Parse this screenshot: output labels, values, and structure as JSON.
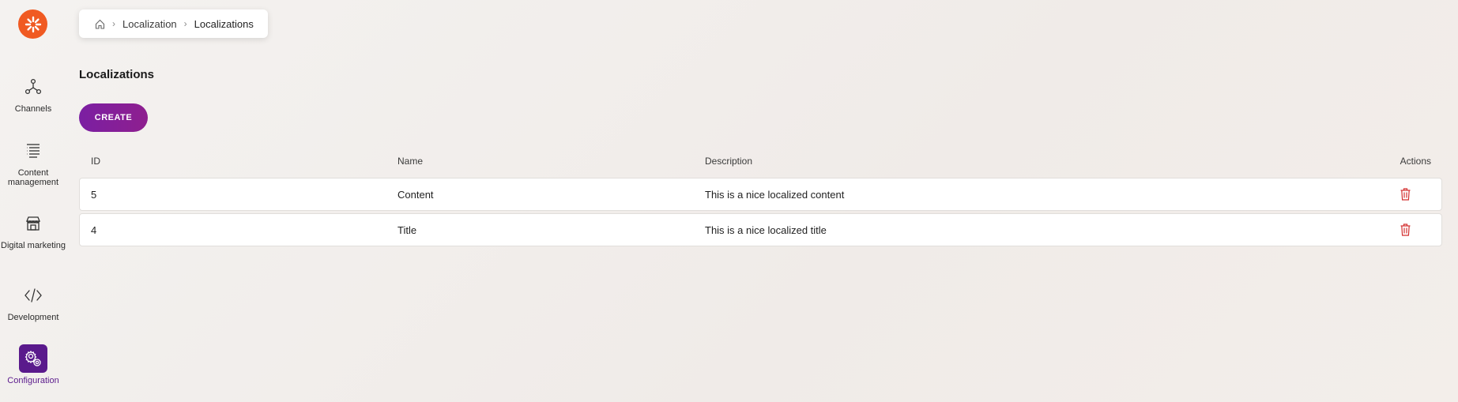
{
  "sidebar": {
    "items": [
      {
        "label": "Channels",
        "icon": "channels-icon"
      },
      {
        "label": "Content management",
        "icon": "content-management-icon"
      },
      {
        "label": "Digital marketing",
        "icon": "digital-marketing-icon"
      },
      {
        "label": "Development",
        "icon": "code-icon"
      },
      {
        "label": "Configuration",
        "icon": "gear-icon",
        "active": true
      }
    ]
  },
  "breadcrumb": {
    "home_icon": "home-icon",
    "items": [
      "Localization",
      "Localizations"
    ]
  },
  "page": {
    "title": "Localizations",
    "create_label": "CREATE"
  },
  "table": {
    "columns": [
      "ID",
      "Name",
      "Description",
      "Actions"
    ],
    "rows": [
      {
        "id": "5",
        "name": "Content",
        "description": "This is a nice localized content"
      },
      {
        "id": "4",
        "name": "Title",
        "description": "This is a nice localized title"
      }
    ]
  },
  "colors": {
    "brand_orange": "#f05a22",
    "accent_purple": "#5a1a8c",
    "create_button": "#7b1fa2",
    "delete_red": "#d32f2f"
  }
}
